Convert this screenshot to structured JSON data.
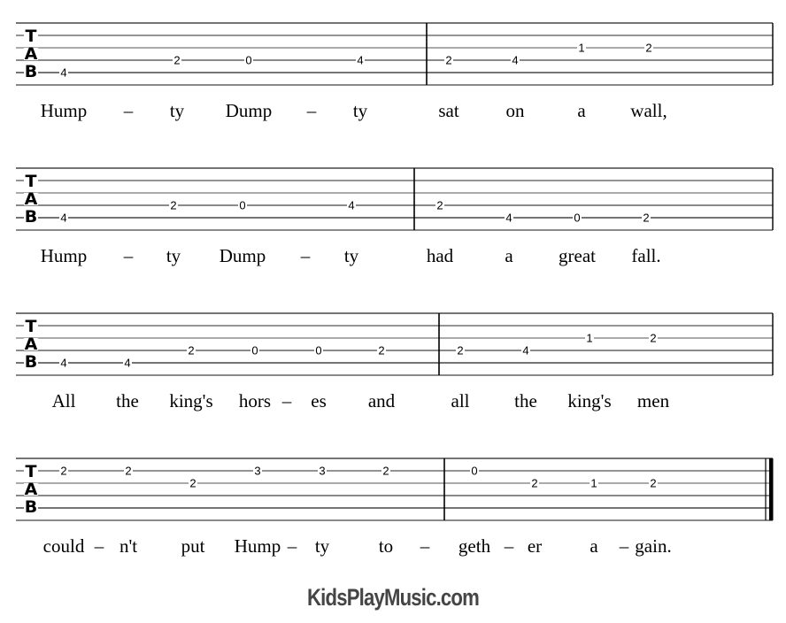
{
  "document": {
    "type": "guitar tablature",
    "staff_label": [
      "T",
      "A",
      "B"
    ],
    "strings": 6
  },
  "systems": [
    {
      "measures": [
        {
          "notes": [
            {
              "string": 5,
              "fret": "4",
              "lyric": "Hump"
            },
            {
              "string": 0,
              "fret": null,
              "lyric": "–"
            },
            {
              "string": 4,
              "fret": "2",
              "lyric": "ty"
            },
            {
              "string": 4,
              "fret": "0",
              "lyric": "Dump"
            },
            {
              "string": 0,
              "fret": null,
              "lyric": "–"
            },
            {
              "string": 4,
              "fret": "4",
              "lyric": "ty"
            }
          ]
        },
        {
          "notes": [
            {
              "string": 4,
              "fret": "2",
              "lyric": "sat"
            },
            {
              "string": 4,
              "fret": "4",
              "lyric": "on"
            },
            {
              "string": 3,
              "fret": "1",
              "lyric": "a"
            },
            {
              "string": 3,
              "fret": "2",
              "lyric": "wall,"
            }
          ]
        }
      ]
    },
    {
      "measures": [
        {
          "notes": [
            {
              "string": 5,
              "fret": "4",
              "lyric": "Hump"
            },
            {
              "string": 0,
              "fret": null,
              "lyric": "–"
            },
            {
              "string": 4,
              "fret": "2",
              "lyric": "ty"
            },
            {
              "string": 4,
              "fret": "0",
              "lyric": "Dump"
            },
            {
              "string": 0,
              "fret": null,
              "lyric": "–"
            },
            {
              "string": 4,
              "fret": "4",
              "lyric": "ty"
            }
          ]
        },
        {
          "notes": [
            {
              "string": 4,
              "fret": "2",
              "lyric": "had"
            },
            {
              "string": 5,
              "fret": "4",
              "lyric": "a"
            },
            {
              "string": 5,
              "fret": "0",
              "lyric": "great"
            },
            {
              "string": 5,
              "fret": "2",
              "lyric": "fall."
            }
          ]
        }
      ]
    },
    {
      "measures": [
        {
          "notes": [
            {
              "string": 5,
              "fret": "4",
              "lyric": "All"
            },
            {
              "string": 5,
              "fret": "4",
              "lyric": "the"
            },
            {
              "string": 4,
              "fret": "2",
              "lyric": "king's"
            },
            {
              "string": 4,
              "fret": "0",
              "lyric": "hors"
            },
            {
              "string": 0,
              "fret": null,
              "lyric": "–"
            },
            {
              "string": 4,
              "fret": "0",
              "lyric": "es"
            },
            {
              "string": 4,
              "fret": "2",
              "lyric": "and"
            }
          ]
        },
        {
          "notes": [
            {
              "string": 4,
              "fret": "2",
              "lyric": "all"
            },
            {
              "string": 4,
              "fret": "4",
              "lyric": "the"
            },
            {
              "string": 3,
              "fret": "1",
              "lyric": "king's"
            },
            {
              "string": 3,
              "fret": "2",
              "lyric": "men"
            }
          ]
        }
      ]
    },
    {
      "measures": [
        {
          "notes": [
            {
              "string": 2,
              "fret": "2",
              "lyric": "could"
            },
            {
              "string": 0,
              "fret": null,
              "lyric": "–"
            },
            {
              "string": 2,
              "fret": "2",
              "lyric": "n't"
            },
            {
              "string": 3,
              "fret": "2",
              "lyric": "put"
            },
            {
              "string": 2,
              "fret": "3",
              "lyric": "Hump"
            },
            {
              "string": 0,
              "fret": null,
              "lyric": "–"
            },
            {
              "string": 2,
              "fret": "3",
              "lyric": "ty"
            },
            {
              "string": 2,
              "fret": "2",
              "lyric": "to"
            },
            {
              "string": 0,
              "fret": null,
              "lyric": "–"
            }
          ]
        },
        {
          "notes": [
            {
              "string": 2,
              "fret": "0",
              "lyric": "geth"
            },
            {
              "string": 0,
              "fret": null,
              "lyric": "–"
            },
            {
              "string": 3,
              "fret": "2",
              "lyric": "er"
            },
            {
              "string": 3,
              "fret": "1",
              "lyric": "a"
            },
            {
              "string": 0,
              "fret": null,
              "lyric": "–"
            },
            {
              "string": 3,
              "fret": "2",
              "lyric": "gain."
            }
          ]
        }
      ],
      "final": true
    }
  ],
  "footer": {
    "brand": "KidsPlayMusic.com"
  }
}
